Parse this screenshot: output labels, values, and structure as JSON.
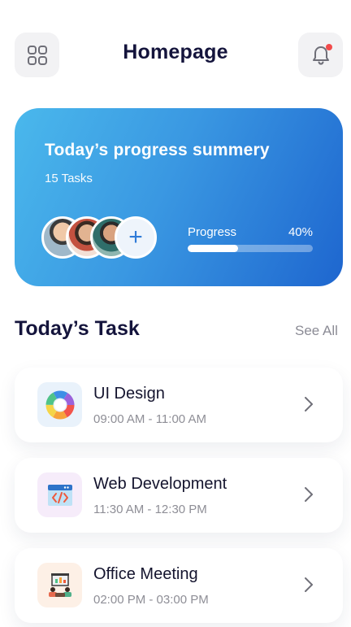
{
  "header": {
    "title": "Homepage",
    "menu_icon": "grid-icon",
    "notification_icon": "bell-icon"
  },
  "summary": {
    "title": "Today’s progress summery",
    "tasks_count": "15 Tasks",
    "progress_label": "Progress",
    "progress_text": "40%",
    "progress_fraction": 0.4,
    "add_symbol": "+",
    "gradient_colors": [
      "#4ab8ec",
      "#1e66cf"
    ]
  },
  "tasks_section": {
    "title": "Today’s Task",
    "see_all": "See All"
  },
  "tasks": [
    {
      "name": "UI Design",
      "time": "09:00 AM - 11:00 AM",
      "icon": "color-wheel-icon",
      "icon_bg": "#e9f2fb"
    },
    {
      "name": "Web Development",
      "time": "11:30 AM - 12:30 PM",
      "icon": "code-browser-icon",
      "icon_bg": "#f6ecfa"
    },
    {
      "name": "Office Meeting",
      "time": "02:00 PM - 03:00 PM",
      "icon": "meeting-presentation-icon",
      "icon_bg": "#fdf0e6"
    }
  ]
}
